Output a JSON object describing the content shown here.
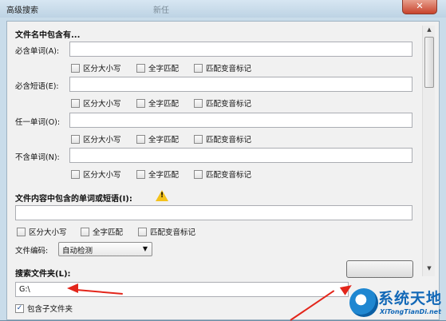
{
  "window": {
    "title": "高级搜索",
    "title_faded": "新任",
    "close_glyph": "✕"
  },
  "filename_section": {
    "heading": "文件名中包含有...",
    "rows": [
      {
        "label": "必含单词(A):",
        "value": ""
      },
      {
        "label": "必含短语(E):",
        "value": ""
      },
      {
        "label": "任一单词(O):",
        "value": ""
      },
      {
        "label": "不含单词(N):",
        "value": ""
      }
    ],
    "options": {
      "match_case": "区分大小写",
      "whole_word": "全字匹配",
      "match_diacritics": "匹配变音标记"
    }
  },
  "content_section": {
    "heading": "文件内容中包含的单词或短语(I):",
    "warning_icon": "warning-icon",
    "value": "",
    "options": {
      "match_case": "区分大小写",
      "whole_word": "全字匹配",
      "match_diacritics": "匹配变音标记"
    },
    "encoding_label": "文件编码:",
    "encoding_value": "自动检测"
  },
  "folder_section": {
    "heading": "搜索文件夹(L):",
    "value": "G:\\",
    "include_subfolders_label": "包含子文件夹",
    "include_subfolders_checked": true
  },
  "watermark": {
    "title": "系统天地",
    "subtitle": "XiTongTianDi.net"
  },
  "colors": {
    "accent_arrow": "#e3261b",
    "watermark_blue": "#1268b7"
  }
}
